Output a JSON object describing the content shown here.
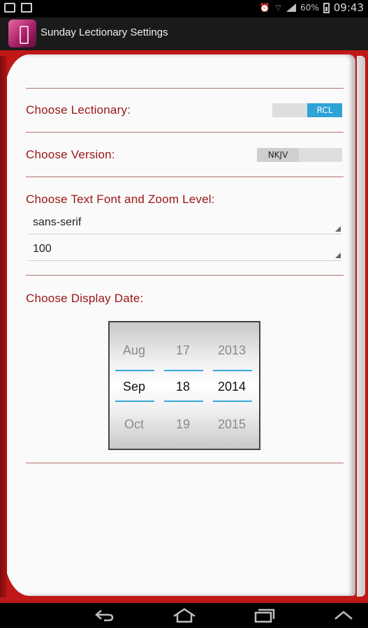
{
  "status": {
    "battery_percent": "60%",
    "time": "09:43"
  },
  "app": {
    "title": "Sunday Lectionary Settings"
  },
  "settings": {
    "lectionary": {
      "label": "Choose Lectionary:",
      "toggle_value": "RCL"
    },
    "version": {
      "label": "Choose Version:",
      "toggle_value": "NKJV"
    },
    "font_zoom": {
      "label": "Choose Text Font and Zoom Level:",
      "font_value": "sans-serif",
      "zoom_value": "100"
    },
    "display_date": {
      "label": "Choose Display Date:",
      "months": [
        "Aug",
        "Sep",
        "Oct"
      ],
      "days": [
        "17",
        "18",
        "19"
      ],
      "years": [
        "2013",
        "2014",
        "2015"
      ]
    }
  },
  "icons": {
    "status_left": [
      "image-icon",
      "clipboard-icon"
    ],
    "status_right": [
      "alarm-icon",
      "wifi-icon",
      "signal-icon",
      "battery-icon"
    ],
    "nav": [
      "back-icon",
      "home-icon",
      "recent-apps-icon",
      "up-chevron-icon"
    ]
  },
  "colors": {
    "accent_red": "#c01818",
    "label_red": "#9a1414",
    "toggle_blue": "#2fa2d6",
    "picker_line": "#38a8d8"
  }
}
